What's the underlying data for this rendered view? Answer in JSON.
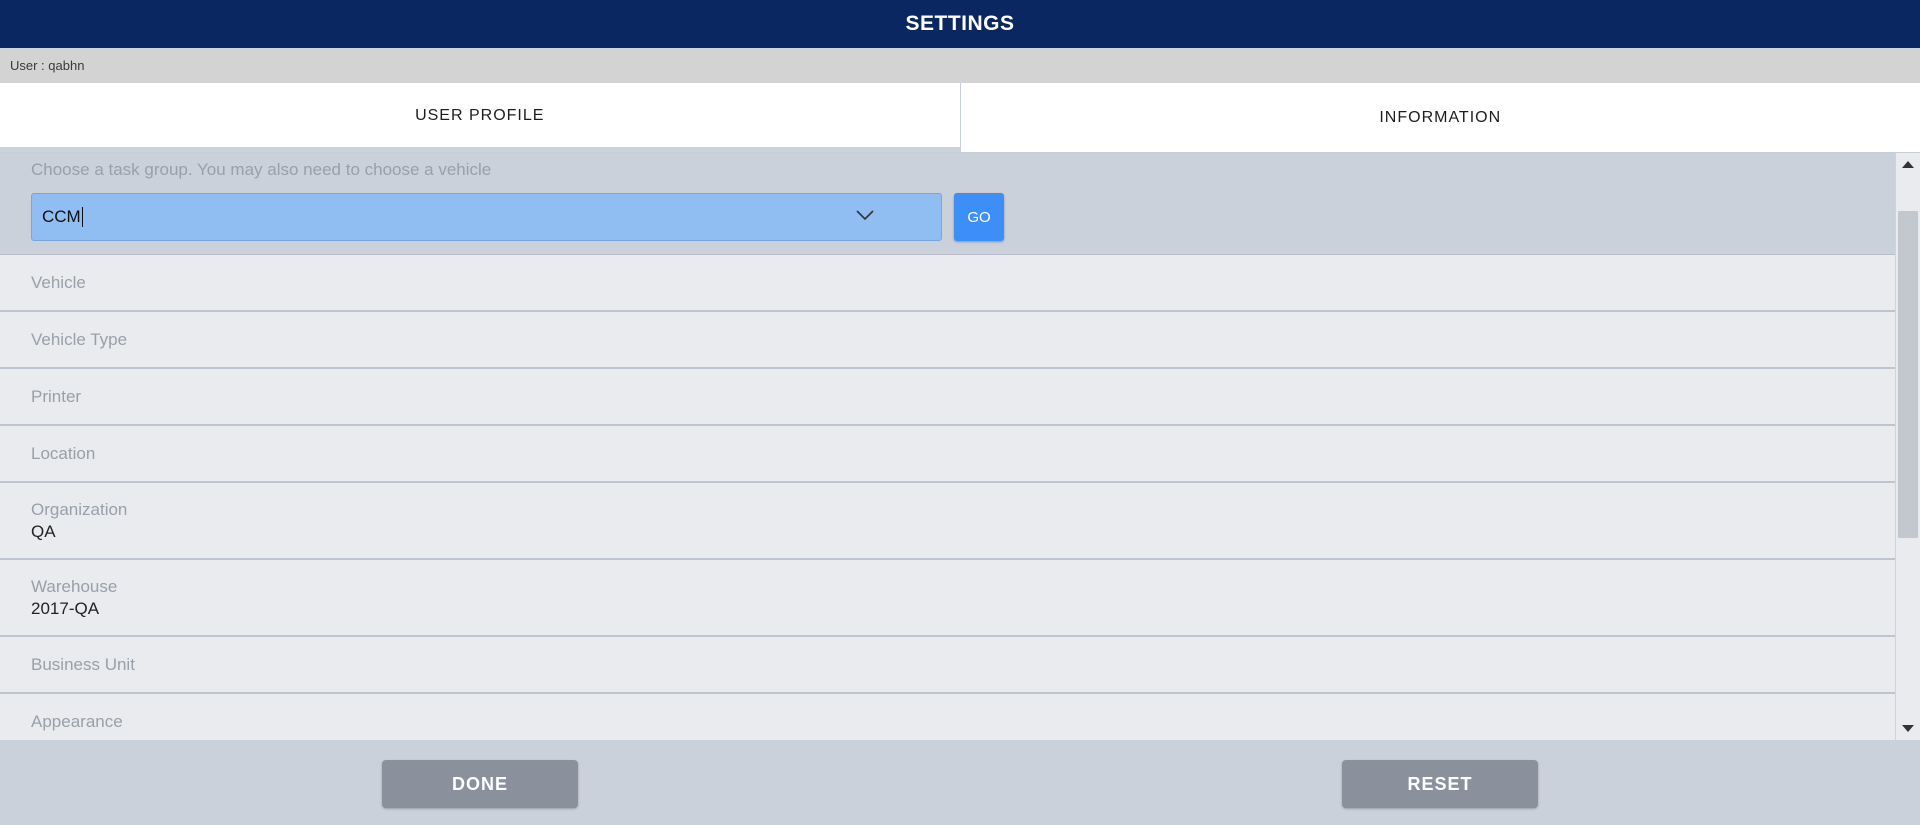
{
  "header": {
    "title": "SETTINGS"
  },
  "user_bar": {
    "text": "User : qabhn"
  },
  "tabs": [
    {
      "label": "USER PROFILE",
      "active": true
    },
    {
      "label": "INFORMATION",
      "active": false
    }
  ],
  "task_group": {
    "instruction": "Choose a task group. You may also need to choose a vehicle",
    "selected_value": "CCM",
    "go_label": "GO"
  },
  "fields": [
    {
      "label": "Vehicle",
      "value": ""
    },
    {
      "label": "Vehicle Type",
      "value": ""
    },
    {
      "label": "Printer",
      "value": ""
    },
    {
      "label": "Location",
      "value": ""
    },
    {
      "label": "Organization",
      "value": "QA"
    },
    {
      "label": "Warehouse",
      "value": "2017-QA"
    },
    {
      "label": "Business Unit",
      "value": ""
    },
    {
      "label": "Appearance",
      "value": ""
    }
  ],
  "footer": {
    "done_label": "DONE",
    "reset_label": "RESET"
  },
  "colors": {
    "title_bar": "#0b2761",
    "select_bg": "#90bdf2",
    "go_button": "#3d8ef7",
    "footer_button": "#8b909d"
  }
}
